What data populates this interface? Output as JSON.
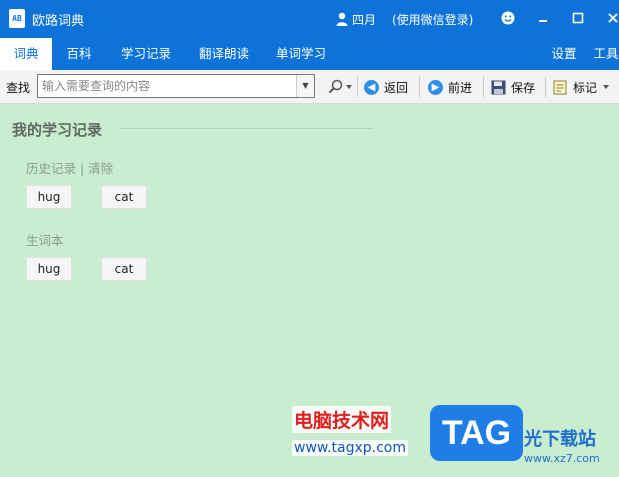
{
  "window": {
    "title": "欧路词典",
    "logo_text": "AB",
    "user_name": "四月",
    "login_hint": "(使用微信登录)"
  },
  "nav": {
    "tabs": [
      {
        "label": "词典",
        "active": true
      },
      {
        "label": "百科"
      },
      {
        "label": "学习记录"
      },
      {
        "label": "翻译朗读"
      },
      {
        "label": "单词学习"
      }
    ],
    "settings_label": "设置",
    "tools_label": "工具"
  },
  "toolbar": {
    "find_label": "查找",
    "search_placeholder": "输入需要查询的内容",
    "back_label": "返回",
    "forward_label": "前进",
    "save_label": "保存",
    "bookmark_label": "标记"
  },
  "content": {
    "section_title": "我的学习记录",
    "history_label": "历史记录",
    "history_separator": "|",
    "history_clear": "清除",
    "history_words": [
      "hug",
      "cat"
    ],
    "vocab_label": "生词本",
    "vocab_words": [
      "hug",
      "cat"
    ]
  },
  "watermark": {
    "site_name": "电脑技术网",
    "site_url": "www.tagxp.com",
    "tag_logo": "TAG",
    "partner_name": "光下载站",
    "partner_url": "www.xz7.com"
  },
  "colors": {
    "titlebar": "#0d73d8",
    "content_bg": "#c9edcf",
    "accent_icon": "#2e8ee8"
  }
}
